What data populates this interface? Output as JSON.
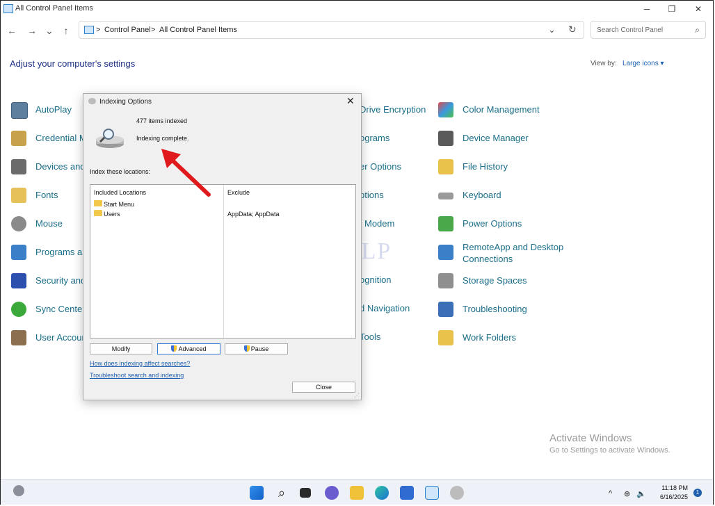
{
  "window": {
    "title": "All Control Panel Items",
    "minimize_glyph": "─",
    "maximize_glyph": "❐",
    "close_glyph": "✕"
  },
  "nav": {
    "back_glyph": "←",
    "forward_glyph": "→",
    "recent_glyph": "⌄",
    "up_glyph": "↑",
    "breadcrumb": [
      "Control Panel",
      "All Control Panel Items"
    ],
    "separator": ">",
    "dropdown_glyph": "⌄",
    "refresh_glyph": "↻"
  },
  "search": {
    "placeholder": "Search Control Panel",
    "glyph": "⌕"
  },
  "page": {
    "heading": "Adjust your computer's settings",
    "view_by_label": "View by:",
    "view_by_value": "Large icons",
    "view_by_arrow": "▾"
  },
  "items": {
    "left": [
      "AutoPlay",
      "Credential M",
      "Devices and",
      "Fonts",
      "Mouse",
      "Programs ar",
      "Security and",
      "Sync Center",
      "User Accour"
    ],
    "middle": [
      "Drive Encryption",
      "ograms",
      "er Options",
      "ptions",
      "Modem",
      "ognition",
      "d Navigation",
      "Tools"
    ],
    "right": [
      "Color Management",
      "Device Manager",
      "File History",
      "Keyboard",
      "Power Options",
      "RemoteApp and Desktop Connections",
      "Storage Spaces",
      "Troubleshooting",
      "Work Folders"
    ]
  },
  "watermark": "IT Pros HLP",
  "activation": {
    "title": "Activate Windows",
    "subtitle": "Go to Settings to activate Windows."
  },
  "dialog": {
    "title": "Indexing Options",
    "close_glyph": "✕",
    "items_indexed": "477 items indexed",
    "status": "Indexing complete.",
    "index_locations_label": "Index these locations:",
    "columns": [
      "Included Locations",
      "Exclude"
    ],
    "locations": [
      {
        "name": "Start Menu",
        "exclude": ""
      },
      {
        "name": "Users",
        "exclude": "AppData; AppData"
      }
    ],
    "buttons": {
      "modify": "Modify",
      "advanced": "Advanced",
      "pause": "Pause",
      "close": "Close"
    },
    "links": [
      "How does indexing affect searches?",
      "Troubleshoot search and indexing"
    ],
    "grip_glyph": "⋰"
  },
  "taskbar": {
    "clock_time": "11:18 PM",
    "clock_date": "6/16/2025",
    "notification_count": "1",
    "tray_chevron": "^",
    "globe_glyph": "⊕",
    "volume_glyph": "🔈",
    "search_glyph": "⌕"
  }
}
